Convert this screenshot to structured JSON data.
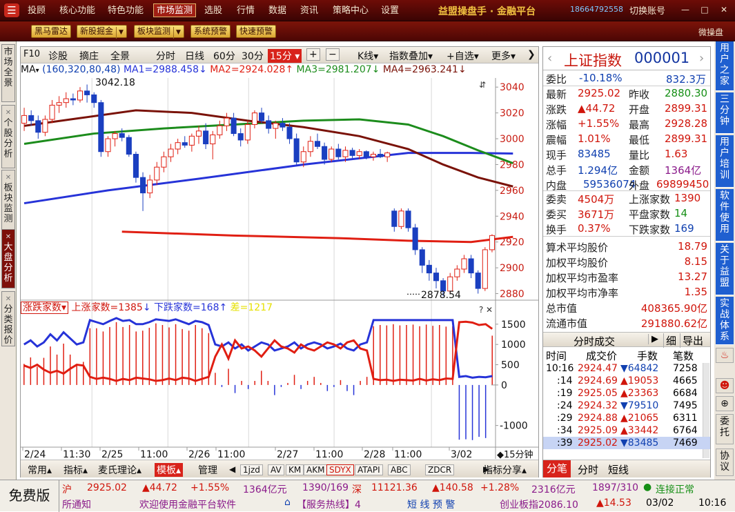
{
  "top_menu": {
    "logo": "☰",
    "items": [
      "投顾",
      "核心功能",
      "特色功能",
      "市场监测",
      "选股",
      "行情",
      "数据",
      "资讯",
      "策略中心",
      "设置"
    ],
    "active": "市场监测",
    "brand": "益盟操盘手 · 金融平台",
    "phone": "18664792558",
    "switch_account": "切换账号",
    "min": "—",
    "max": "□",
    "close": "✕"
  },
  "toolbar": {
    "buttons": [
      "黑马雷达",
      "新股掘金",
      "板块监测",
      "系统预警",
      "快速预警"
    ],
    "wcp": "微操盘"
  },
  "left_tabs": [
    "市场全景",
    "个股分析",
    "板块监测",
    "大盘分析",
    "分类报价"
  ],
  "left_tab_active": "大盘分析",
  "chart_toolbar": {
    "items": [
      "F10",
      "诊股",
      "摘庄",
      "全景",
      "分时",
      "日线",
      "60分",
      "30分",
      "15分",
      "K线",
      "指数叠加",
      "自选",
      "更多"
    ],
    "selected": "15分",
    "plus": "+",
    "minus": "−"
  },
  "ma_line": {
    "prefix": "MA",
    "params": "(160,320,80,48)",
    "ma1": "MA1=2988.458",
    "ma2": "MA2=2924.028",
    "ma3": "MA3=2981.207",
    "ma4": "MA4=2963.241"
  },
  "indicator_line": {
    "name": "涨跌家数",
    "up": "上涨家数=1385",
    "down": "下跌家数=168",
    "diff": "差=1217"
  },
  "chart_data": [
    {
      "type": "candlestick",
      "title": "",
      "y_ticks": [
        3040,
        3020,
        3000,
        2980,
        2960,
        2940,
        2920,
        2900,
        2880
      ],
      "ylim": [
        2876,
        3046
      ],
      "high_label": "3042.18",
      "low_label": "2878.54",
      "x_labels": [
        "2/24",
        "11:30",
        "2/25",
        "11:00",
        "2/26",
        "11:00",
        "2/27",
        "11:00",
        "2/28",
        "11:00",
        "3/02"
      ],
      "interval_label": "15分钟",
      "ohlc": [
        [
          3012,
          3024,
          3006,
          3018
        ],
        [
          3018,
          3022,
          3010,
          3014
        ],
        [
          3014,
          3018,
          3000,
          3005
        ],
        [
          3005,
          3018,
          3002,
          3015
        ],
        [
          3015,
          3030,
          3012,
          3026
        ],
        [
          3026,
          3033,
          3020,
          3028
        ],
        [
          3028,
          3036,
          3024,
          3031
        ],
        [
          3031,
          3035,
          3026,
          3030
        ],
        [
          3030,
          3040,
          3028,
          3037
        ],
        [
          3037,
          3042,
          3028,
          3034
        ],
        [
          3034,
          3036,
          3024,
          3028
        ],
        [
          3028,
          3030,
          2986,
          2990
        ],
        [
          2990,
          3002,
          2986,
          3000
        ],
        [
          3000,
          3006,
          2994,
          3004
        ],
        [
          3004,
          3008,
          2998,
          3001
        ],
        [
          3001,
          3003,
          2986,
          2988
        ],
        [
          2988,
          2990,
          2966,
          2970
        ],
        [
          2970,
          2974,
          2944,
          2958
        ],
        [
          2958,
          2972,
          2954,
          2968
        ],
        [
          2968,
          2982,
          2964,
          2978
        ],
        [
          2978,
          2990,
          2974,
          2986
        ],
        [
          2986,
          2996,
          2982,
          2992
        ],
        [
          2992,
          3000,
          2988,
          2997
        ],
        [
          2997,
          3002,
          2993,
          2995
        ],
        [
          2995,
          3004,
          2990,
          3002
        ],
        [
          3002,
          3010,
          2996,
          3006
        ],
        [
          3006,
          3012,
          2992,
          2996
        ],
        [
          2996,
          3006,
          2984,
          3003
        ],
        [
          3003,
          3014,
          3000,
          3010
        ],
        [
          3010,
          3020,
          3006,
          3016
        ],
        [
          3016,
          3020,
          3002,
          3004
        ],
        [
          3004,
          3008,
          2994,
          2999
        ],
        [
          2999,
          3014,
          2996,
          3011
        ],
        [
          3011,
          3022,
          3008,
          3020
        ],
        [
          3020,
          3024,
          3012,
          3014
        ],
        [
          3014,
          3018,
          3004,
          3008
        ],
        [
          3008,
          3014,
          3000,
          3012
        ],
        [
          3012,
          3016,
          3006,
          3009
        ],
        [
          3009,
          3012,
          2996,
          3000
        ],
        [
          3000,
          3004,
          2980,
          2982
        ],
        [
          2982,
          2994,
          2978,
          2990
        ],
        [
          2990,
          3002,
          2986,
          2998
        ],
        [
          2998,
          3004,
          2992,
          2994
        ],
        [
          2994,
          2997,
          2980,
          2984
        ],
        [
          2984,
          2994,
          2982,
          2992
        ],
        [
          2992,
          2996,
          2984,
          2986
        ],
        [
          2986,
          2994,
          2982,
          2991
        ],
        [
          2991,
          2993,
          2985,
          2987
        ],
        [
          2987,
          2992,
          2984,
          2990
        ],
        [
          2990,
          2991,
          2984,
          2986
        ],
        [
          2986,
          2990,
          2983,
          2988
        ],
        [
          2988,
          2992,
          2985,
          2986
        ],
        [
          2986,
          2990,
          2982,
          2989
        ],
        [
          2944,
          2946,
          2928,
          2932
        ],
        [
          2932,
          2946,
          2930,
          2944
        ],
        [
          2944,
          2946,
          2928,
          2931
        ],
        [
          2931,
          2934,
          2910,
          2914
        ],
        [
          2914,
          2916,
          2896,
          2902
        ],
        [
          2902,
          2906,
          2890,
          2896
        ],
        [
          2896,
          2900,
          2884,
          2890
        ],
        [
          2890,
          2892,
          2878,
          2882
        ],
        [
          2882,
          2896,
          2880,
          2893
        ],
        [
          2893,
          2902,
          2890,
          2899
        ],
        [
          2899,
          2910,
          2896,
          2907
        ],
        [
          2907,
          2910,
          2892,
          2896
        ],
        [
          2896,
          2898,
          2880,
          2884
        ],
        [
          2884,
          2916,
          2882,
          2914
        ],
        [
          2914,
          2926,
          2912,
          2925
        ]
      ],
      "ma_lines": [
        {
          "name": "MA1",
          "color": "#2633d8",
          "values": [
            [
              0,
              2950
            ],
            [
              12,
              2960
            ],
            [
              25,
              2969
            ],
            [
              40,
              2980
            ],
            [
              55,
              2989
            ],
            [
              64,
              2989
            ],
            [
              70,
              2988.5
            ]
          ]
        },
        {
          "name": "MA2",
          "color": "#e01e12",
          "values": [
            [
              14,
              2928
            ],
            [
              30,
              2925
            ],
            [
              45,
              2923
            ],
            [
              55,
              2921
            ],
            [
              64,
              2920
            ],
            [
              70,
              2924
            ]
          ]
        },
        {
          "name": "MA3",
          "color": "#1c8c1c",
          "values": [
            [
              0,
              2996
            ],
            [
              10,
              3004
            ],
            [
              20,
              3008
            ],
            [
              30,
              3011
            ],
            [
              40,
              3014
            ],
            [
              48,
              3015
            ],
            [
              55,
              3011
            ],
            [
              60,
              3002
            ],
            [
              65,
              2991
            ],
            [
              70,
              2981
            ]
          ]
        },
        {
          "name": "MA4",
          "color": "#7a1208",
          "values": [
            [
              0,
              3010
            ],
            [
              8,
              3016
            ],
            [
              16,
              3022
            ],
            [
              24,
              3020
            ],
            [
              32,
              3014
            ],
            [
              40,
              3009
            ],
            [
              48,
              3002
            ],
            [
              55,
              2992
            ],
            [
              60,
              2980
            ],
            [
              65,
              2970
            ],
            [
              70,
              2963
            ]
          ]
        }
      ]
    },
    {
      "type": "line",
      "title": "涨跌家数",
      "y_ticks": [
        1500,
        1000,
        500,
        0,
        -1000
      ],
      "ylim": [
        -1500,
        1650
      ],
      "up_series": [
        1000,
        1100,
        950,
        1050,
        1250,
        1100,
        1300,
        1150,
        1000,
        1050,
        1600,
        1550,
        1500,
        1580,
        1650,
        1580,
        1600,
        1500,
        1500,
        1550,
        1620,
        1600,
        1580,
        1620,
        1560,
        1500,
        1580,
        1550,
        1480,
        1000,
        950,
        1050,
        900,
        1000,
        850,
        950,
        1050,
        1000,
        850,
        900,
        950,
        1050,
        900,
        1000,
        1050,
        1000,
        900,
        950,
        1020,
        900,
        850,
        1000,
        1050,
        1600,
        1600,
        1600,
        1600,
        1600,
        1600,
        1600,
        1600,
        1600,
        1600,
        1600,
        1600,
        1600,
        200,
        220,
        180,
        200,
        190,
        220
      ],
      "down_series": [
        480,
        420,
        500,
        380,
        300,
        350,
        280,
        400,
        500,
        480,
        200,
        150,
        180,
        150,
        100,
        150,
        120,
        180,
        160,
        140,
        100,
        120,
        160,
        120,
        180,
        160,
        100,
        150,
        200,
        700,
        1000,
        650,
        1100,
        900,
        950,
        850,
        700,
        900,
        1100,
        950,
        900,
        800,
        1000,
        900,
        850,
        950,
        1050,
        1000,
        900,
        1050,
        1100,
        900,
        850,
        150,
        120,
        130,
        100,
        130,
        120,
        110,
        150,
        110,
        140,
        120,
        160,
        150,
        1550,
        1560,
        1540,
        1480,
        1500,
        1385
      ],
      "bars": [
        520,
        680,
        450,
        670,
        950,
        750,
        1020,
        750,
        500,
        570,
        1400,
        1400,
        1320,
        1430,
        1550,
        1430,
        1480,
        1320,
        1340,
        1410,
        1520,
        1480,
        1420,
        1500,
        1380,
        1340,
        1480,
        1400,
        1280,
        300,
        -50,
        400,
        -200,
        100,
        -100,
        100,
        350,
        100,
        -250,
        -50,
        50,
        250,
        -100,
        100,
        200,
        50,
        -150,
        -50,
        120,
        -150,
        -250,
        100,
        200,
        1450,
        1480,
        1470,
        1500,
        1470,
        1480,
        1490,
        1450,
        1490,
        1460,
        1480,
        1440,
        1450,
        -1350,
        -1340,
        -1360,
        -1280,
        -1310,
        1217
      ]
    }
  ],
  "quote_panel": {
    "title": "上证指数",
    "code": "000001",
    "rows": [
      [
        "委比",
        "-10.18%",
        "",
        "832.3万"
      ],
      [
        "最新",
        "2925.02",
        "昨收",
        "2880.30"
      ],
      [
        "涨跌",
        "▲44.72",
        "开盘",
        "2899.31"
      ],
      [
        "涨幅",
        "+1.55%",
        "最高",
        "2928.28"
      ],
      [
        "震幅",
        "1.01%",
        "最低",
        "2899.31"
      ],
      [
        "现手",
        "83485",
        "量比",
        "1.63"
      ],
      [
        "总手",
        "1.294亿",
        "金额",
        "1364亿"
      ],
      [
        "内盘",
        "59536074",
        "外盘",
        "69899450"
      ],
      [
        "委卖",
        "4504万",
        "上涨家数",
        "1390"
      ],
      [
        "委买",
        "3671万",
        "平盘家数",
        "14"
      ],
      [
        "换手",
        "0.37%",
        "下跌家数",
        "169"
      ]
    ],
    "stats": [
      [
        "算术平均股价",
        "18.79"
      ],
      [
        "加权平均股价",
        "8.15"
      ],
      [
        "加权平均市盈率",
        "13.27"
      ],
      [
        "加权平均市净率",
        "1.35"
      ],
      [
        "总市值",
        "408365.90亿"
      ],
      [
        "流通市值",
        "291880.62亿"
      ]
    ],
    "tick_title": "分时成交",
    "tick_btns": [
      "▶",
      "细",
      "导出"
    ],
    "tick_headers": [
      "时间",
      "成交价",
      "手数",
      "笔数"
    ],
    "ticks": [
      [
        "10:16",
        "2924.47",
        "▼64842",
        "7258"
      ],
      [
        ":14",
        "2924.69",
        "▲19053",
        "4665"
      ],
      [
        ":19",
        "2925.05",
        "▲23363",
        "6684"
      ],
      [
        ":24",
        "2924.32",
        "▼79510",
        "7495"
      ],
      [
        ":29",
        "2924.88",
        "▲21065",
        "6311"
      ],
      [
        ":34",
        "2925.09",
        "▲33442",
        "6764"
      ],
      [
        ":39",
        "2925.02",
        "▼83485",
        "7469"
      ]
    ],
    "bottom_tabs": [
      "分笔",
      "分时",
      "短线"
    ]
  },
  "far_right": [
    "用户之家",
    "三分钟",
    "用户培训",
    "软件使用",
    "关于益盟",
    "实战体系",
    "委托",
    "协议"
  ],
  "bottom_tabs": [
    "常用",
    "指标",
    "麦氏理论",
    "模板",
    "管理",
    "1jzd",
    "AV",
    "KM",
    "AKM",
    "SDYX",
    "ATAPI",
    "ABC",
    "ZDCR",
    "指标分享"
  ],
  "bottom_tab_selected": "模板",
  "status": {
    "free": "免费版",
    "sh_label": "沪",
    "sh_price": "2925.02",
    "sh_chg": "▲44.72",
    "sh_pct": "+1.55%",
    "sh_amt": "1364亿元",
    "sh_updown": "1390/169",
    "sz_label": "深",
    "sz_price": "11121.36",
    "sz_chg": "▲140.58",
    "sz_pct": "+1.28%",
    "sz_amt": "2316亿元",
    "sz_updown": "1897/310",
    "conn": "连接正常",
    "notice": "所通知",
    "welcome": "欢迎使用金融平台软件",
    "hotline": "【服务热线】4",
    "alert": "短 线 预 警",
    "cyb": "创业板指2086.10",
    "cyb_chg": "▲14.53",
    "date": "03/02",
    "time": "10:16"
  }
}
